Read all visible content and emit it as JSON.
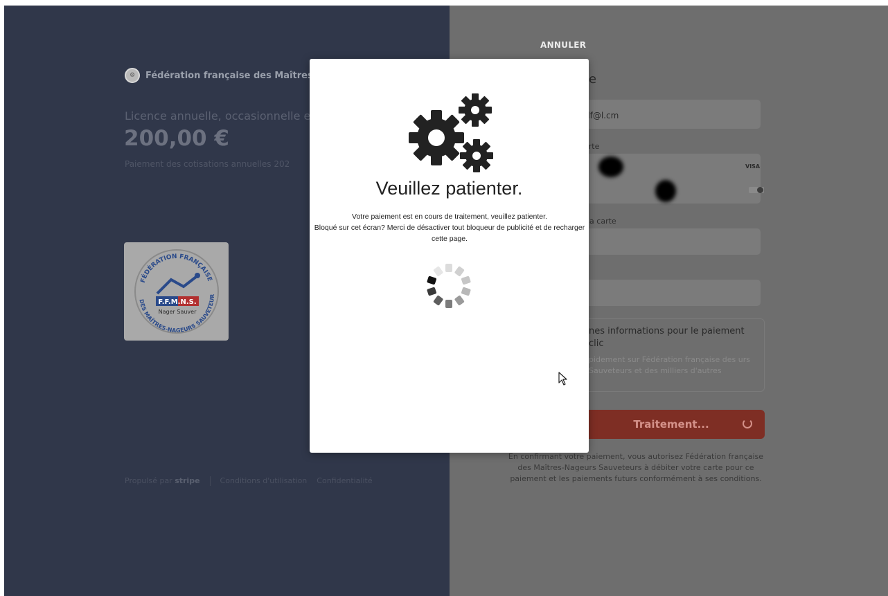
{
  "left_panel": {
    "merchant_name": "Fédération française des Maîtres-N",
    "product_name": "Licence annuelle, occasionnelle et d",
    "price": "200,00 €",
    "price_description": "Paiement des cotisations annuelles 202",
    "product_image_lines": [
      "FÉDÉRATION FRANÇAISE",
      "DES MAÎTRES-NAGEURS SAUVETEURS",
      "F.F.M.N.S.",
      "Nager Sauver"
    ],
    "footer": {
      "powered_by": "Propulsé par",
      "stripe": "stripe",
      "terms": "Conditions d'utilisation",
      "privacy": "Confidentialité"
    }
  },
  "right_panel": {
    "cancel_label": "ANNULER",
    "title_fragment": "te",
    "email_value": "df@l.cm",
    "card_label_fragment": "arte",
    "card_brand": "VISA",
    "cardholder_label_fragment": "la carte",
    "save_info_title": "nes informations pour le paiement clic",
    "save_info_desc": "pidement sur Fédération française des urs Sauveteurs et des milliers d'autres",
    "pay_button_label": "Traitement...",
    "legal_text": "En confirmant votre paiement, vous autorisez Fédération française des Maîtres-Nageurs Sauveteurs à débiter votre carte pour ce paiement et les paiements futurs conformément à ses conditions."
  },
  "modal": {
    "title": "Veuillez patienter.",
    "line1": "Votre paiement est en cours de traitement, veuillez patienter.",
    "line2": "Bloqué sur cet écran? Merci de désactiver tout bloqueur de publicité et de recharger cette page."
  },
  "colors": {
    "left_bg": "#30374a",
    "right_overlay": "#6e6e6e",
    "button": "#7e2e24"
  }
}
